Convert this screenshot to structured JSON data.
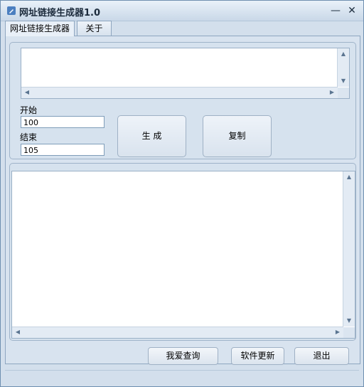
{
  "window": {
    "title": "网址链接生成器1.0",
    "minimize_glyph": "—",
    "close_glyph": "✕"
  },
  "tabs": [
    {
      "label": "网址链接生成器",
      "active": true
    },
    {
      "label": "关于",
      "active": false
    }
  ],
  "top_output": {
    "value": ""
  },
  "start": {
    "label": "开始",
    "value": "100"
  },
  "end": {
    "label": "结束",
    "value": "105"
  },
  "buttons": {
    "generate": "生 成",
    "copy": "复制",
    "query": "我爱查询",
    "update": "软件更新",
    "exit": "退出"
  },
  "result": {
    "value": ""
  },
  "icons": {
    "app": "pencil-icon",
    "scroll_up": "▲",
    "scroll_down": "▼",
    "scroll_left": "◀",
    "scroll_right": "▶"
  }
}
